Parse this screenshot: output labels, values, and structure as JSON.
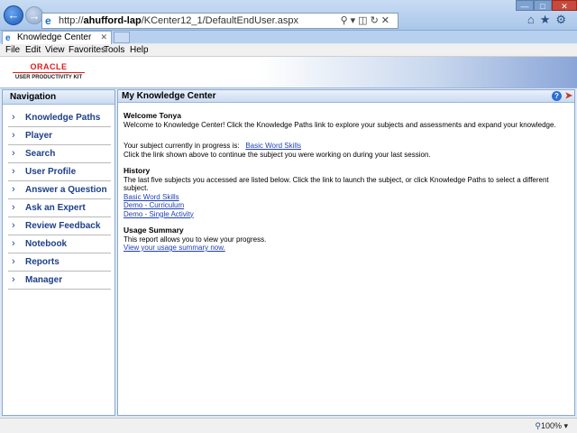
{
  "browser": {
    "address": "http://ahufford-lap/KCenter12_1/DefaultEndUser.aspx",
    "address_host": "ahufford-lap",
    "address_prefix": "http://",
    "address_path": "/KCenter12_1/DefaultEndUser.aspx",
    "tab_title": "Knowledge Center",
    "menu": [
      "File",
      "Edit",
      "View",
      "Favorites",
      "Tools",
      "Help"
    ],
    "zoom": "100%"
  },
  "header": {
    "logo_brand": "ORACLE",
    "logo_product": "USER PRODUCTIVITY KIT"
  },
  "sidebar": {
    "title": "Navigation",
    "items": [
      {
        "label": "Knowledge Paths"
      },
      {
        "label": "Player"
      },
      {
        "label": "Search"
      },
      {
        "label": "User Profile"
      },
      {
        "label": "Answer a Question"
      },
      {
        "label": "Ask an Expert"
      },
      {
        "label": "Review Feedback"
      },
      {
        "label": "Notebook"
      },
      {
        "label": "Reports"
      },
      {
        "label": "Manager"
      }
    ]
  },
  "main": {
    "title": "My Knowledge Center",
    "welcome_heading": "Welcome Tonya",
    "welcome_text": "Welcome to Knowledge Center! Click the Knowledge Paths link to explore your subjects and assessments and expand your knowledge.",
    "in_progress_label": "Your subject currently in progress is:",
    "in_progress_link": "Basic Word Skills",
    "in_progress_hint": "Click the link shown above to continue the subject you were working on during your last session.",
    "history_heading": "History",
    "history_text": "The last five subjects you accessed are listed below. Click the link to launch the subject, or click Knowledge Paths to select a different subject.",
    "history_links": [
      "Basic Word Skills",
      "Demo - Curriculum",
      "Demo - Single Activity"
    ],
    "usage_heading": "Usage Summary",
    "usage_text": "This report allows you to view your progress.",
    "usage_link": "View your usage summary now."
  }
}
